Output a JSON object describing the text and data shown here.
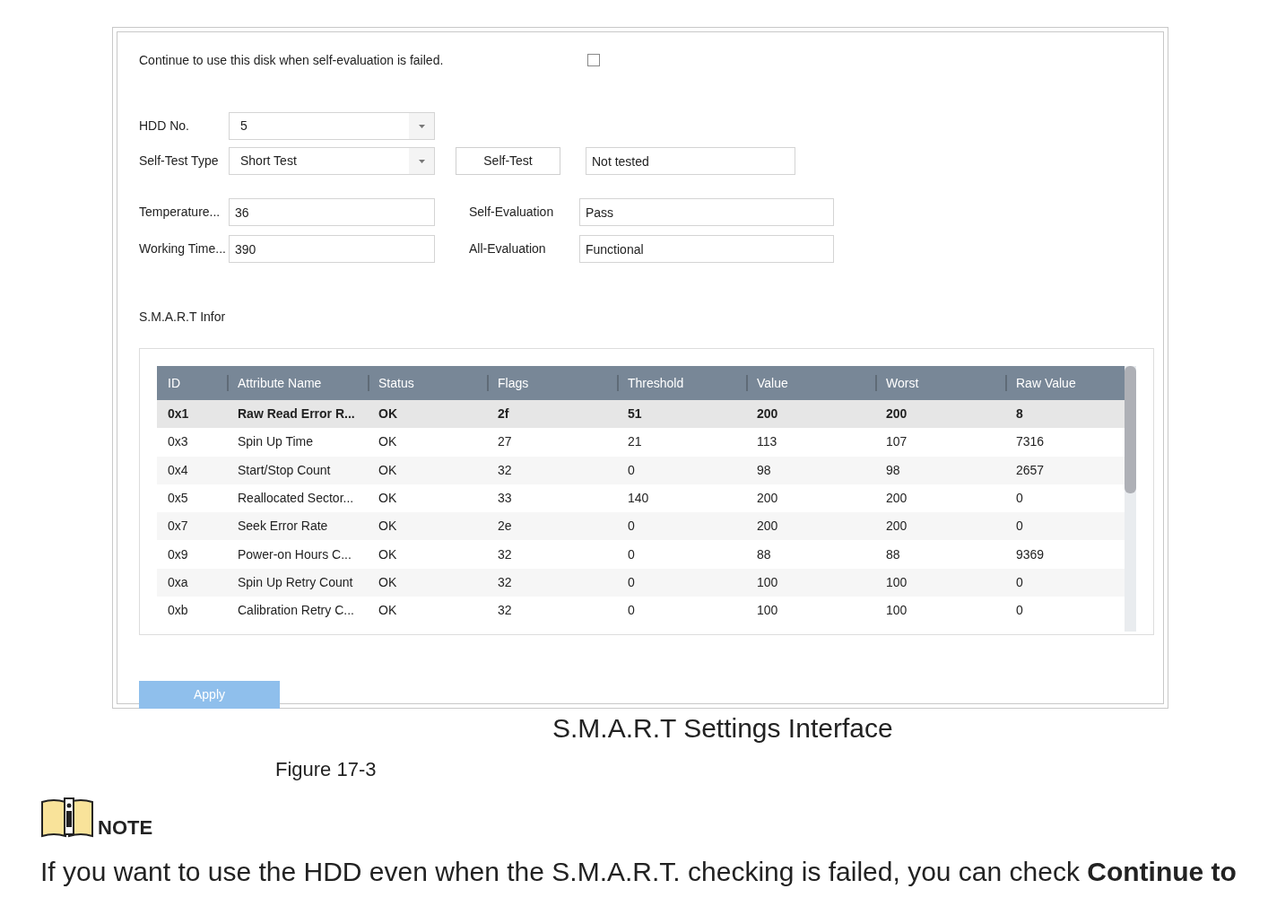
{
  "settings": {
    "continue_label": "Continue to use this disk when self-evaluation is failed.",
    "continue_checked": false,
    "hdd_no": {
      "label": "HDD No.",
      "value": "5"
    },
    "self_test_type": {
      "label": "Self-Test Type",
      "value": "Short Test"
    },
    "self_test_button": "Self-Test",
    "self_test_result": "Not tested",
    "temperature": {
      "label": "Temperature...",
      "value": "36"
    },
    "working_time": {
      "label": "Working Time...",
      "value": "390"
    },
    "self_evaluation": {
      "label": "Self-Evaluation",
      "value": "Pass"
    },
    "all_evaluation": {
      "label": "All-Evaluation",
      "value": "Functional"
    }
  },
  "smart_title": "S.M.A.R.T Infor",
  "table": {
    "columns": [
      "ID",
      "Attribute Name",
      "Status",
      "Flags",
      "Threshold",
      "Value",
      "Worst",
      "Raw Value"
    ],
    "rows": [
      {
        "selected": true,
        "cells": [
          "0x1",
          "Raw Read Error R...",
          "OK",
          "2f",
          "51",
          "200",
          "200",
          "8"
        ]
      },
      {
        "selected": false,
        "cells": [
          "0x3",
          "Spin Up Time",
          "OK",
          "27",
          "21",
          "113",
          "107",
          "7316"
        ]
      },
      {
        "selected": false,
        "cells": [
          "0x4",
          "Start/Stop Count",
          "OK",
          "32",
          "0",
          "98",
          "98",
          "2657"
        ]
      },
      {
        "selected": false,
        "cells": [
          "0x5",
          "Reallocated Sector...",
          "OK",
          "33",
          "140",
          "200",
          "200",
          "0"
        ]
      },
      {
        "selected": false,
        "cells": [
          "0x7",
          "Seek Error Rate",
          "OK",
          "2e",
          "0",
          "200",
          "200",
          "0"
        ]
      },
      {
        "selected": false,
        "cells": [
          "0x9",
          "Power-on Hours C...",
          "OK",
          "32",
          "0",
          "88",
          "88",
          "9369"
        ]
      },
      {
        "selected": false,
        "cells": [
          "0xa",
          "Spin Up Retry Count",
          "OK",
          "32",
          "0",
          "100",
          "100",
          "0"
        ]
      },
      {
        "selected": false,
        "cells": [
          "0xb",
          "Calibration Retry C...",
          "OK",
          "32",
          "0",
          "100",
          "100",
          "0"
        ]
      }
    ]
  },
  "apply_button": {
    "label": "Apply",
    "disabled": true
  },
  "caption": "S.M.A.R.T Settings Interface",
  "figure_label": "Figure 17-3",
  "note": {
    "title": "NOTE",
    "text": "If you want to use the HDD even when the S.M.A.R.T. checking is failed, you can check **Continue to**"
  }
}
